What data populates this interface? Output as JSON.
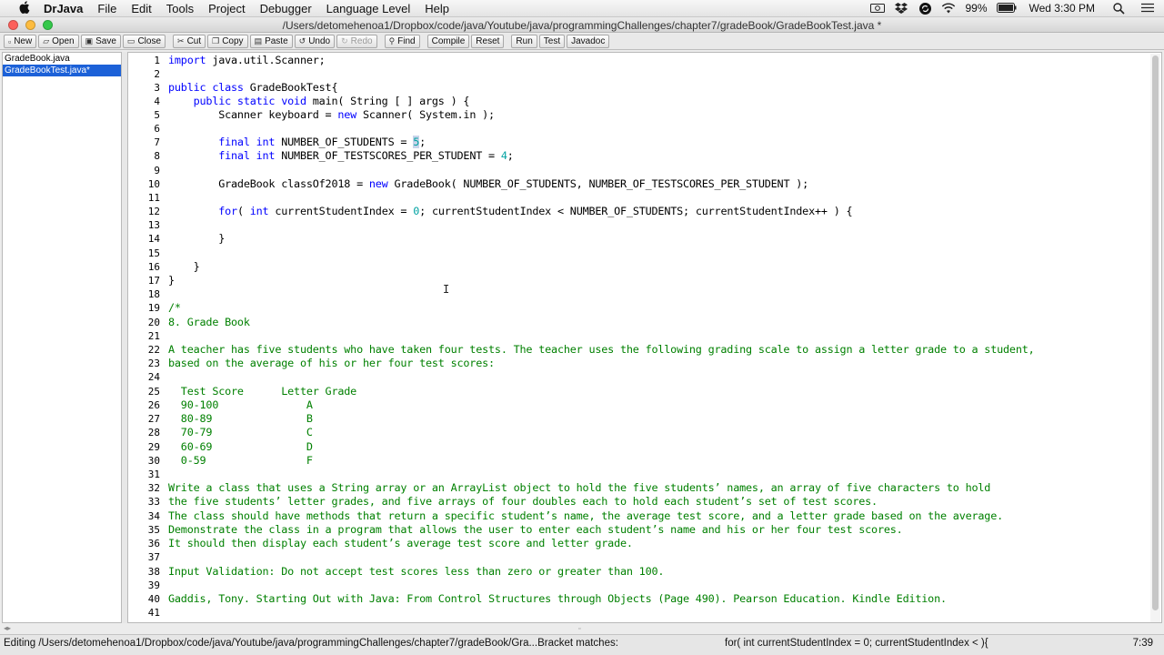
{
  "menubar": {
    "app": "DrJava",
    "items": [
      "File",
      "Edit",
      "Tools",
      "Project",
      "Debugger",
      "Language Level",
      "Help"
    ],
    "battery": "99%",
    "clock": "Wed 3:30 PM"
  },
  "window": {
    "title": "/Users/detomehenoa1/Dropbox/code/java/Youtube/java/programmingChallenges/chapter7/gradeBook/GradeBookTest.java *"
  },
  "toolbar": {
    "new": "New",
    "open": "Open",
    "save": "Save",
    "close": "Close",
    "cut": "Cut",
    "copy": "Copy",
    "paste": "Paste",
    "undo": "Undo",
    "redo": "Redo",
    "find": "Find",
    "compile": "Compile",
    "reset": "Reset",
    "run": "Run",
    "test": "Test",
    "javadoc": "Javadoc"
  },
  "files": [
    "GradeBook.java",
    "GradeBookTest.java*"
  ],
  "code": {
    "line_numbers": [
      "1",
      "2",
      "3",
      "4",
      "5",
      "6",
      "7",
      "8",
      "9",
      "10",
      "11",
      "12",
      "13",
      "14",
      "15",
      "16",
      "17",
      "18",
      "19",
      "20",
      "21",
      "22",
      "23",
      "24",
      "25",
      "26",
      "27",
      "28",
      "29",
      "30",
      "31",
      "32",
      "33",
      "34",
      "35",
      "36",
      "37",
      "38",
      "39",
      "40",
      "41"
    ],
    "l1a": "import",
    "l1b": " java.util.Scanner;",
    "l3a": "public class",
    "l3b": " GradeBookTest{",
    "l4a": "    public static void",
    "l4b": " main( String [ ] args ) {",
    "l5a": "        Scanner keyboard = ",
    "l5b": "new",
    "l5c": " Scanner( System.in );",
    "l7a": "        final int",
    "l7b": " NUMBER_OF_STUDENTS = ",
    "l7c": "5",
    "l7d": ";",
    "l8a": "        final int",
    "l8b": " NUMBER_OF_TESTSCORES_PER_STUDENT = ",
    "l8c": "4",
    "l8d": ";",
    "l10a": "        GradeBook classOf2018 = ",
    "l10b": "new",
    "l10c": " GradeBook( NUMBER_OF_STUDENTS, NUMBER_OF_TESTSCORES_PER_STUDENT );",
    "l12a": "        for",
    "l12b": "( ",
    "l12c": "int",
    "l12d": " currentStudentIndex = ",
    "l12e": "0",
    "l12f": "; currentStudentIndex < NUMBER_OF_STUDENTS; currentStudentIndex++ ) {",
    "l14": "        }",
    "l16": "    }",
    "l17": "}",
    "l19": "/*",
    "l20": "8. Grade Book",
    "l22": "A teacher has five students who have taken four tests. The teacher uses the following grading scale to assign a letter grade to a student,",
    "l23": "based on the average of his or her four test scores:",
    "l25": "  Test Score      Letter Grade",
    "l26": "  90-100              A",
    "l27": "  80-89               B",
    "l28": "  70-79               C",
    "l29": "  60-69               D",
    "l30": "  0-59                F",
    "l32": "Write a class that uses a String array or an ArrayList object to hold the five students’ names, an array of five characters to hold",
    "l33": "the five students’ letter grades, and five arrays of four doubles each to hold each student’s set of test scores.",
    "l34": "The class should have methods that return a specific student’s name, the average test score, and a letter grade based on the average.",
    "l35": "Demonstrate the class in a program that allows the user to enter each student’s name and his or her four test scores.",
    "l36": "It should then display each student’s average test score and letter grade.",
    "l38": "Input Validation: Do not accept test scores less than zero or greater than 100.",
    "l40": "Gaddis, Tony. Starting Out with Java: From Control Structures through Objects (Page 490). Pearson Education. Kindle Edition."
  },
  "status": {
    "left": "Editing /Users/detomehenoa1/Dropbox/code/java/Youtube/java/programmingChallenges/chapter7/gradeBook/Gra...Bracket matches:",
    "bracket": "for( int currentStudentIndex = 0; currentStudentIndex <  ){",
    "position": "7:39"
  },
  "colors": {
    "keyword": "#0000ff",
    "number": "#00a2a2",
    "comment": "#008000",
    "selection": "#1c61d8"
  },
  "icons": [
    "apple-icon",
    "camera-icon",
    "dropbox-icon",
    "sync-icon",
    "wifi-icon",
    "battery-icon",
    "search-icon",
    "list-icon"
  ]
}
